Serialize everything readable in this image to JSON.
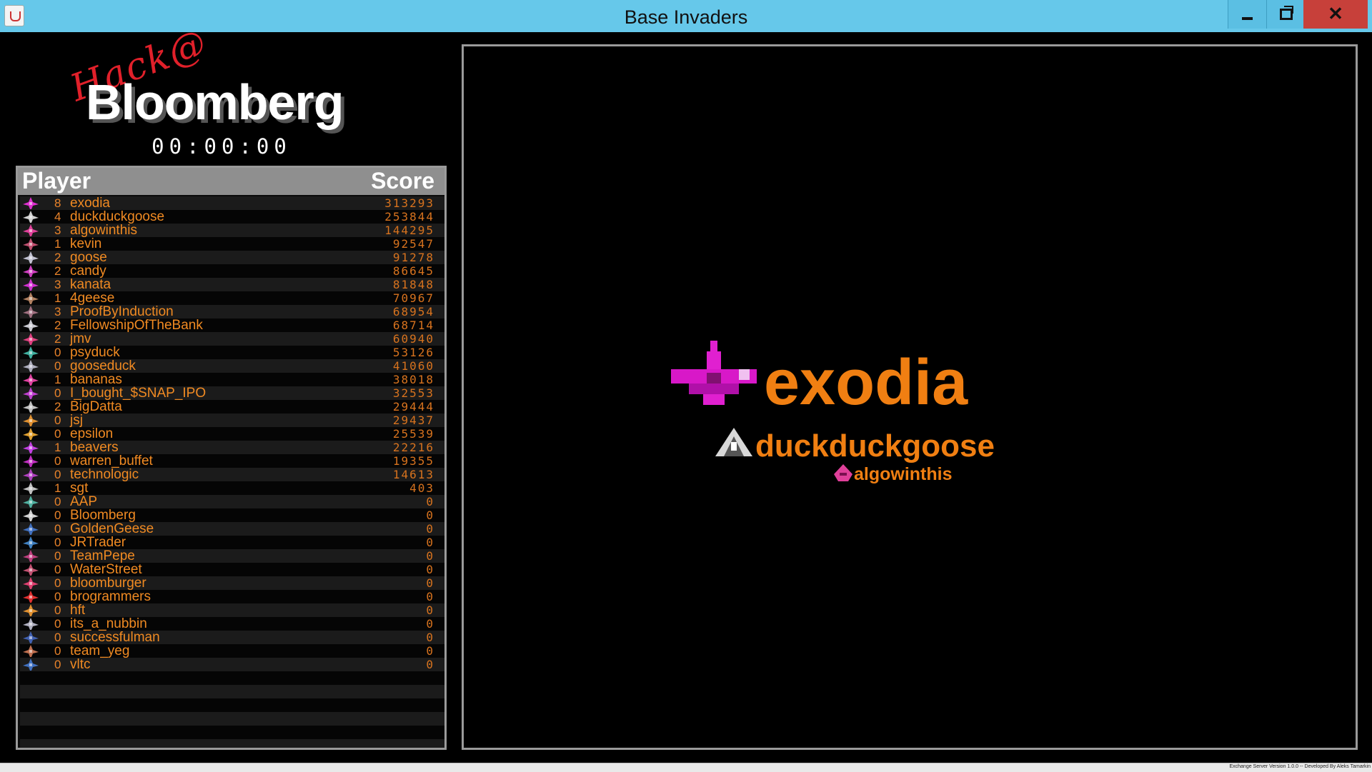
{
  "window": {
    "title": "Base Invaders"
  },
  "logo": {
    "prefix": "Hack@",
    "name": "Bloomberg"
  },
  "timer": "00:00:00",
  "scoreboard": {
    "player_header": "Player",
    "score_header": "Score",
    "rows": [
      {
        "level": "8",
        "name": "exodia",
        "score": "313293",
        "color": "#e030d0"
      },
      {
        "level": "4",
        "name": "duckduckgoose",
        "score": "253844",
        "color": "#d0d0d0"
      },
      {
        "level": "3",
        "name": "algowinthis",
        "score": "144295",
        "color": "#e0409a"
      },
      {
        "level": "1",
        "name": "kevin",
        "score": "92547",
        "color": "#c05070"
      },
      {
        "level": "2",
        "name": "goose",
        "score": "91278",
        "color": "#c0c0d0"
      },
      {
        "level": "2",
        "name": "candy",
        "score": "86645",
        "color": "#d040c0"
      },
      {
        "level": "3",
        "name": "kanata",
        "score": "81848",
        "color": "#d030d0"
      },
      {
        "level": "1",
        "name": "4geese",
        "score": "70967",
        "color": "#b08060"
      },
      {
        "level": "3",
        "name": "ProofByInduction",
        "score": "68954",
        "color": "#a07080"
      },
      {
        "level": "2",
        "name": "FellowshipOfTheBank",
        "score": "68714",
        "color": "#c8c8d0"
      },
      {
        "level": "2",
        "name": "jmv",
        "score": "60940",
        "color": "#e04080"
      },
      {
        "level": "0",
        "name": "psyduck",
        "score": "53126",
        "color": "#40b0a0"
      },
      {
        "level": "0",
        "name": "gooseduck",
        "score": "41060",
        "color": "#b0b0c0"
      },
      {
        "level": "1",
        "name": "bananas",
        "score": "38018",
        "color": "#e040a0"
      },
      {
        "level": "0",
        "name": "I_bought_$SNAP_IPO",
        "score": "32553",
        "color": "#c040d0"
      },
      {
        "level": "2",
        "name": "BigDatta",
        "score": "29444",
        "color": "#c0c0c0"
      },
      {
        "level": "0",
        "name": "jsj",
        "score": "29437",
        "color": "#e09030"
      },
      {
        "level": "0",
        "name": "epsilon",
        "score": "25539",
        "color": "#e0a030"
      },
      {
        "level": "1",
        "name": "beavers",
        "score": "22216",
        "color": "#c040e0"
      },
      {
        "level": "0",
        "name": "warren_buffet",
        "score": "19355",
        "color": "#c030c0"
      },
      {
        "level": "0",
        "name": "technologic",
        "score": "14613",
        "color": "#b040c0"
      },
      {
        "level": "1",
        "name": "sgt",
        "score": "403",
        "color": "#c0c0c0"
      },
      {
        "level": "0",
        "name": "AAP",
        "score": "0",
        "color": "#50b0a0"
      },
      {
        "level": "0",
        "name": "Bloomberg",
        "score": "0",
        "color": "#d0d0d0"
      },
      {
        "level": "0",
        "name": "GoldenGeese",
        "score": "0",
        "color": "#4070c0"
      },
      {
        "level": "0",
        "name": "JRTrader",
        "score": "0",
        "color": "#4080c0"
      },
      {
        "level": "0",
        "name": "TeamPepe",
        "score": "0",
        "color": "#c04080"
      },
      {
        "level": "0",
        "name": "WaterStreet",
        "score": "0",
        "color": "#c05070"
      },
      {
        "level": "0",
        "name": "bloomburger",
        "score": "0",
        "color": "#e04070"
      },
      {
        "level": "0",
        "name": "brogrammers",
        "score": "0",
        "color": "#e03030"
      },
      {
        "level": "0",
        "name": "hft",
        "score": "0",
        "color": "#e09030"
      },
      {
        "level": "0",
        "name": "its_a_nubbin",
        "score": "0",
        "color": "#b0b0c0"
      },
      {
        "level": "0",
        "name": "successfulman",
        "score": "0",
        "color": "#4060b0"
      },
      {
        "level": "0",
        "name": "team_yeg",
        "score": "0",
        "color": "#c07050"
      },
      {
        "level": "0",
        "name": "vltc",
        "score": "0",
        "color": "#4070c0"
      }
    ]
  },
  "podium": {
    "first": "exodia",
    "second": "duckduckgoose",
    "third": "algowinthis"
  },
  "status": {
    "text": "Exchange Server Version 1.0.0 -- Developed By Aleks Tamarkin"
  }
}
